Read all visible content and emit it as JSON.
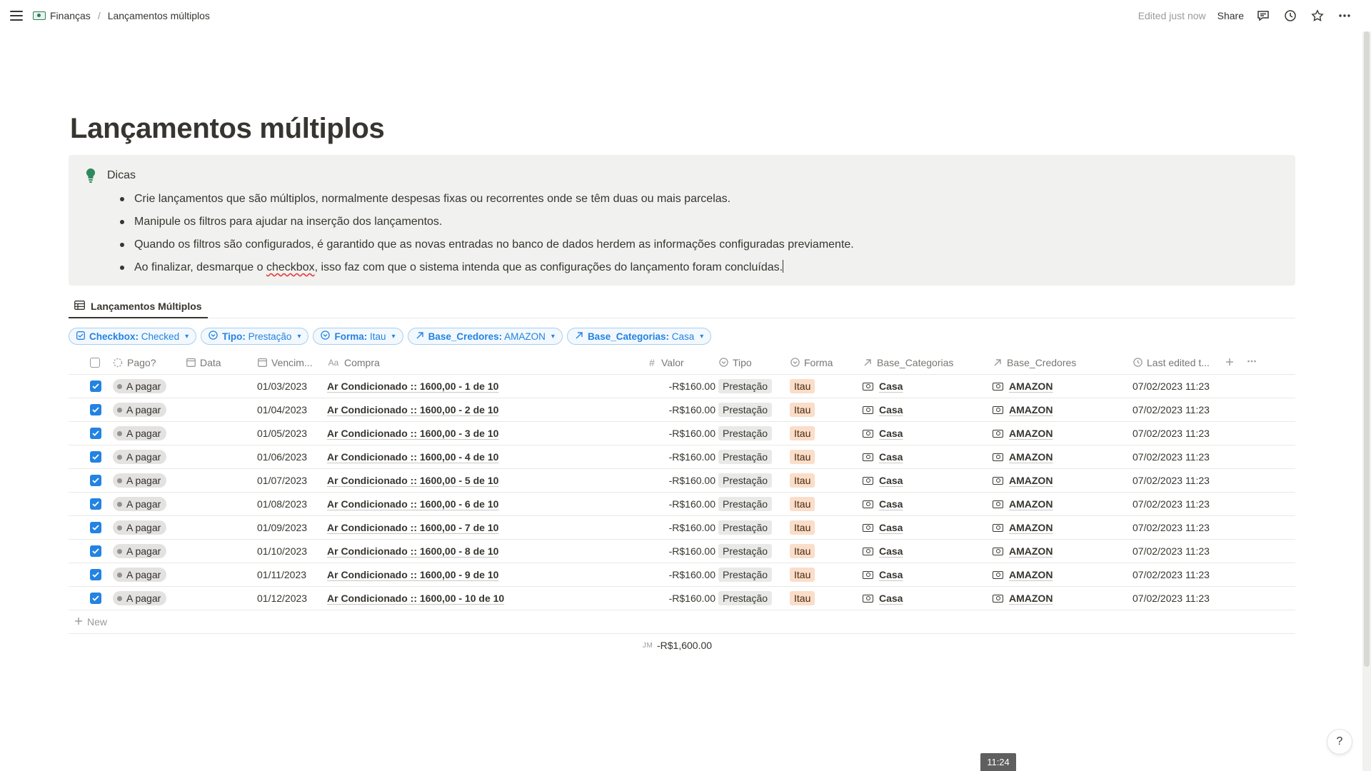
{
  "topbar": {
    "breadcrumb": [
      "Finanças",
      "Lançamentos múltiplos"
    ],
    "edited": "Edited just now",
    "share": "Share"
  },
  "page": {
    "title": "Lançamentos múltiplos",
    "callout": {
      "heading": "Dicas",
      "items": [
        "Crie lançamentos que são múltiplos, normalmente despesas fixas ou recorrentes onde se têm duas ou mais parcelas.",
        "Manipule os filtros para ajudar na inserção dos lançamentos.",
        "Quando os filtros são configurados, é garantido que as novas entradas no banco de dados herdem as informações configuradas previamente."
      ],
      "last_item": {
        "before": "Ao finalizar, desmarque o ",
        "highlight": "checkbox",
        "after": ", isso faz com que o sistema intenda que as configurações do lançamento foram concluídas."
      }
    }
  },
  "view": {
    "tab_label": "Lançamentos Múltiplos"
  },
  "filters": [
    {
      "key": "Checkbox:",
      "value": "Checked",
      "icon": "checkbox-icon"
    },
    {
      "key": "Tipo:",
      "value": "Prestação",
      "icon": "select-icon"
    },
    {
      "key": "Forma:",
      "value": "Itau",
      "icon": "select-icon"
    },
    {
      "key": "Base_Credores:",
      "value": "AMAZON",
      "icon": "relation-arrow-icon"
    },
    {
      "key": "Base_Categorias:",
      "value": "Casa",
      "icon": "relation-arrow-icon"
    }
  ],
  "table": {
    "columns": {
      "pago": "Pago?",
      "data": "Data",
      "venc": "Vencim...",
      "compra": "Compra",
      "valor": "Valor",
      "tipo": "Tipo",
      "forma": "Forma",
      "cat": "Base_Categorias",
      "cred": "Base_Credores",
      "edit": "Last edited t..."
    },
    "rows": [
      {
        "pago": "A pagar",
        "venc": "01/03/2023",
        "compra": "Ar Condicionado :: 1600,00 - 1 de 10",
        "valor": "-R$160.00",
        "tipo": "Prestação",
        "forma": "Itau",
        "cat": "Casa",
        "cred": "AMAZON",
        "edit": "07/02/2023 11:23"
      },
      {
        "pago": "A pagar",
        "venc": "01/04/2023",
        "compra": "Ar Condicionado :: 1600,00 - 2 de 10",
        "valor": "-R$160.00",
        "tipo": "Prestação",
        "forma": "Itau",
        "cat": "Casa",
        "cred": "AMAZON",
        "edit": "07/02/2023 11:23"
      },
      {
        "pago": "A pagar",
        "venc": "01/05/2023",
        "compra": "Ar Condicionado :: 1600,00 - 3 de 10",
        "valor": "-R$160.00",
        "tipo": "Prestação",
        "forma": "Itau",
        "cat": "Casa",
        "cred": "AMAZON",
        "edit": "07/02/2023 11:23"
      },
      {
        "pago": "A pagar",
        "venc": "01/06/2023",
        "compra": "Ar Condicionado :: 1600,00 - 4 de 10",
        "valor": "-R$160.00",
        "tipo": "Prestação",
        "forma": "Itau",
        "cat": "Casa",
        "cred": "AMAZON",
        "edit": "07/02/2023 11:23"
      },
      {
        "pago": "A pagar",
        "venc": "01/07/2023",
        "compra": "Ar Condicionado :: 1600,00 - 5 de 10",
        "valor": "-R$160.00",
        "tipo": "Prestação",
        "forma": "Itau",
        "cat": "Casa",
        "cred": "AMAZON",
        "edit": "07/02/2023 11:23"
      },
      {
        "pago": "A pagar",
        "venc": "01/08/2023",
        "compra": "Ar Condicionado :: 1600,00 - 6 de 10",
        "valor": "-R$160.00",
        "tipo": "Prestação",
        "forma": "Itau",
        "cat": "Casa",
        "cred": "AMAZON",
        "edit": "07/02/2023 11:23"
      },
      {
        "pago": "A pagar",
        "venc": "01/09/2023",
        "compra": "Ar Condicionado :: 1600,00 - 7 de 10",
        "valor": "-R$160.00",
        "tipo": "Prestação",
        "forma": "Itau",
        "cat": "Casa",
        "cred": "AMAZON",
        "edit": "07/02/2023 11:23"
      },
      {
        "pago": "A pagar",
        "venc": "01/10/2023",
        "compra": "Ar Condicionado :: 1600,00 - 8 de 10",
        "valor": "-R$160.00",
        "tipo": "Prestação",
        "forma": "Itau",
        "cat": "Casa",
        "cred": "AMAZON",
        "edit": "07/02/2023 11:23"
      },
      {
        "pago": "A pagar",
        "venc": "01/11/2023",
        "compra": "Ar Condicionado :: 1600,00 - 9 de 10",
        "valor": "-R$160.00",
        "tipo": "Prestação",
        "forma": "Itau",
        "cat": "Casa",
        "cred": "AMAZON",
        "edit": "07/02/2023 11:23"
      },
      {
        "pago": "A pagar",
        "venc": "01/12/2023",
        "compra": "Ar Condicionado :: 1600,00 - 10 de 10",
        "valor": "-R$160.00",
        "tipo": "Prestação",
        "forma": "Itau",
        "cat": "Casa",
        "cred": "AMAZON",
        "edit": "07/02/2023 11:23"
      }
    ],
    "new_label": "New",
    "sum_label": "ЈМ",
    "sum_value": "-R$1,600.00"
  },
  "overlays": {
    "time": "11:24",
    "help": "?"
  },
  "colors": {
    "accent": "#2383e2",
    "forma_tag_bg": "#fadec9",
    "callout_bg": "#f1f1ef"
  }
}
